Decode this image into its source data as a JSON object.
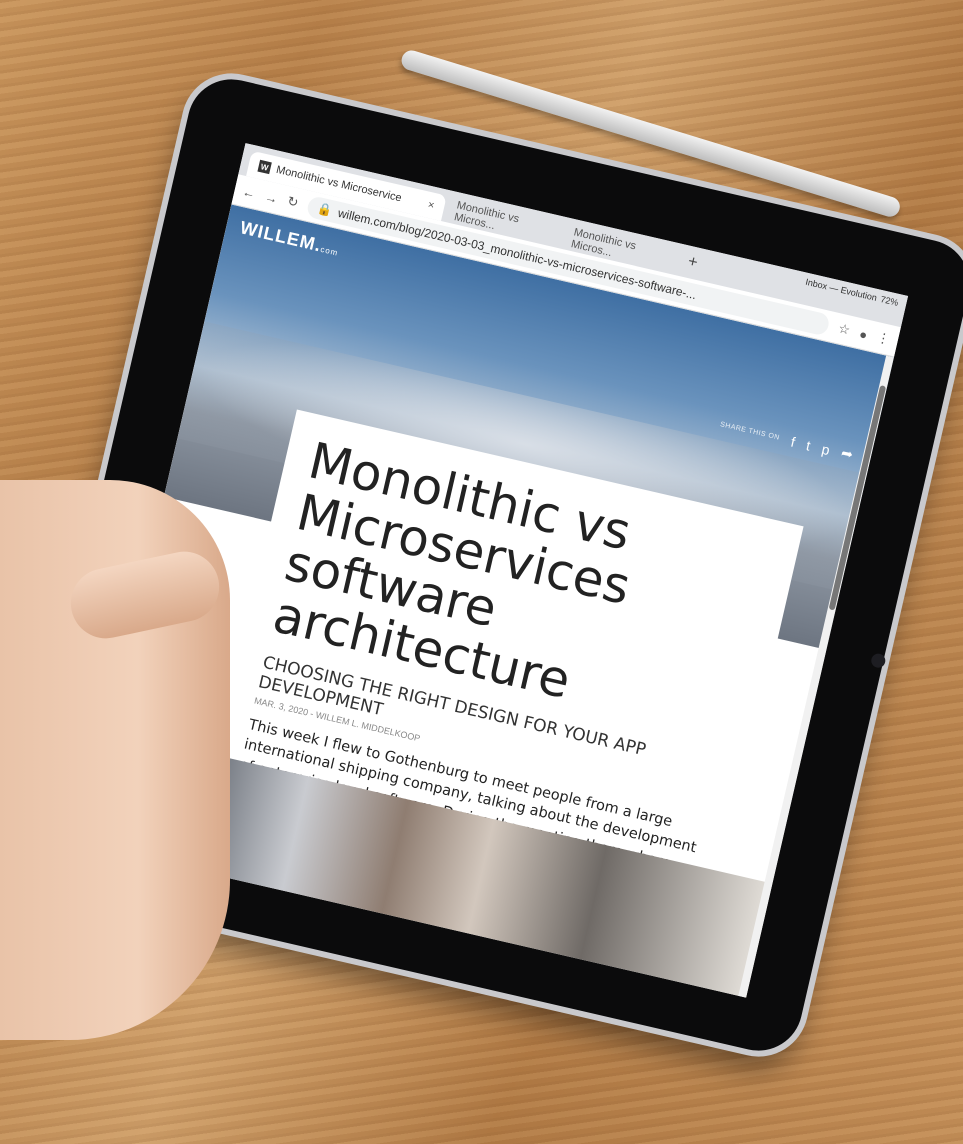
{
  "browser": {
    "tabs": [
      {
        "label": "Monolithic vs Microservice",
        "close": "×",
        "favicon": "W"
      },
      {
        "label": "Monolithic vs Micros..."
      },
      {
        "label": "Monolithic vs Micros..."
      }
    ],
    "new_tab": "+",
    "window_title": "Inbox — Evolution",
    "url": "willem.com/blog/2020-03-03_monolithic-vs-microservices-software-...",
    "battery": "72%"
  },
  "site": {
    "logo": "WILLEM.",
    "logo_suffix": "com",
    "share_label": "SHARE THIS ON"
  },
  "article": {
    "title": "Monolithic vs Microservices software architecture",
    "subtitle": "CHOOSING THE RIGHT DESIGN FOR YOUR APP DEVELOPMENT",
    "meta": "MAR. 3, 2020 - WILLEM L. MIDDELKOOP",
    "body": "This week I flew to Gothenburg to meet people from a large international shipping company, talking about the development of enterprise level software. During the meeting there where various experts in the room, one of them asked me on choosing the right software architecture (for big, complex, enterprise level apps). A very good question, well worthy for a blog post."
  }
}
